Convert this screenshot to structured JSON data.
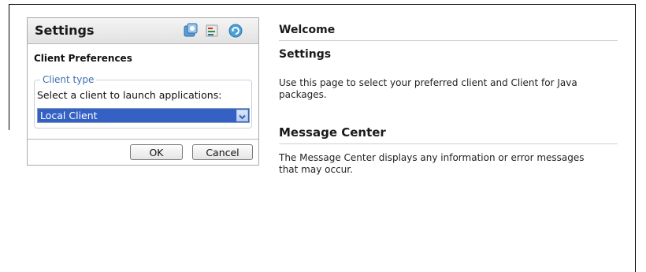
{
  "settings_panel": {
    "title": "Settings",
    "icons": [
      "applications-icon",
      "preferences-icon",
      "refresh-icon"
    ],
    "section_title": "Client Preferences",
    "client_type": {
      "legend": "Client type",
      "prompt": "Select a client to launch applications:",
      "selected": "Local Client"
    },
    "ok_label": "OK",
    "cancel_label": "Cancel"
  },
  "content": {
    "welcome_heading": "Welcome",
    "settings_heading": "Settings",
    "settings_text": "Use this page to select your preferred client and Client for Java packages.",
    "message_center_heading": "Message Center",
    "message_center_text": "The Message Center displays any information or error messages that may occur."
  },
  "colors": {
    "selection_bg": "#3561c5",
    "legend_text": "#3a6fb0"
  }
}
